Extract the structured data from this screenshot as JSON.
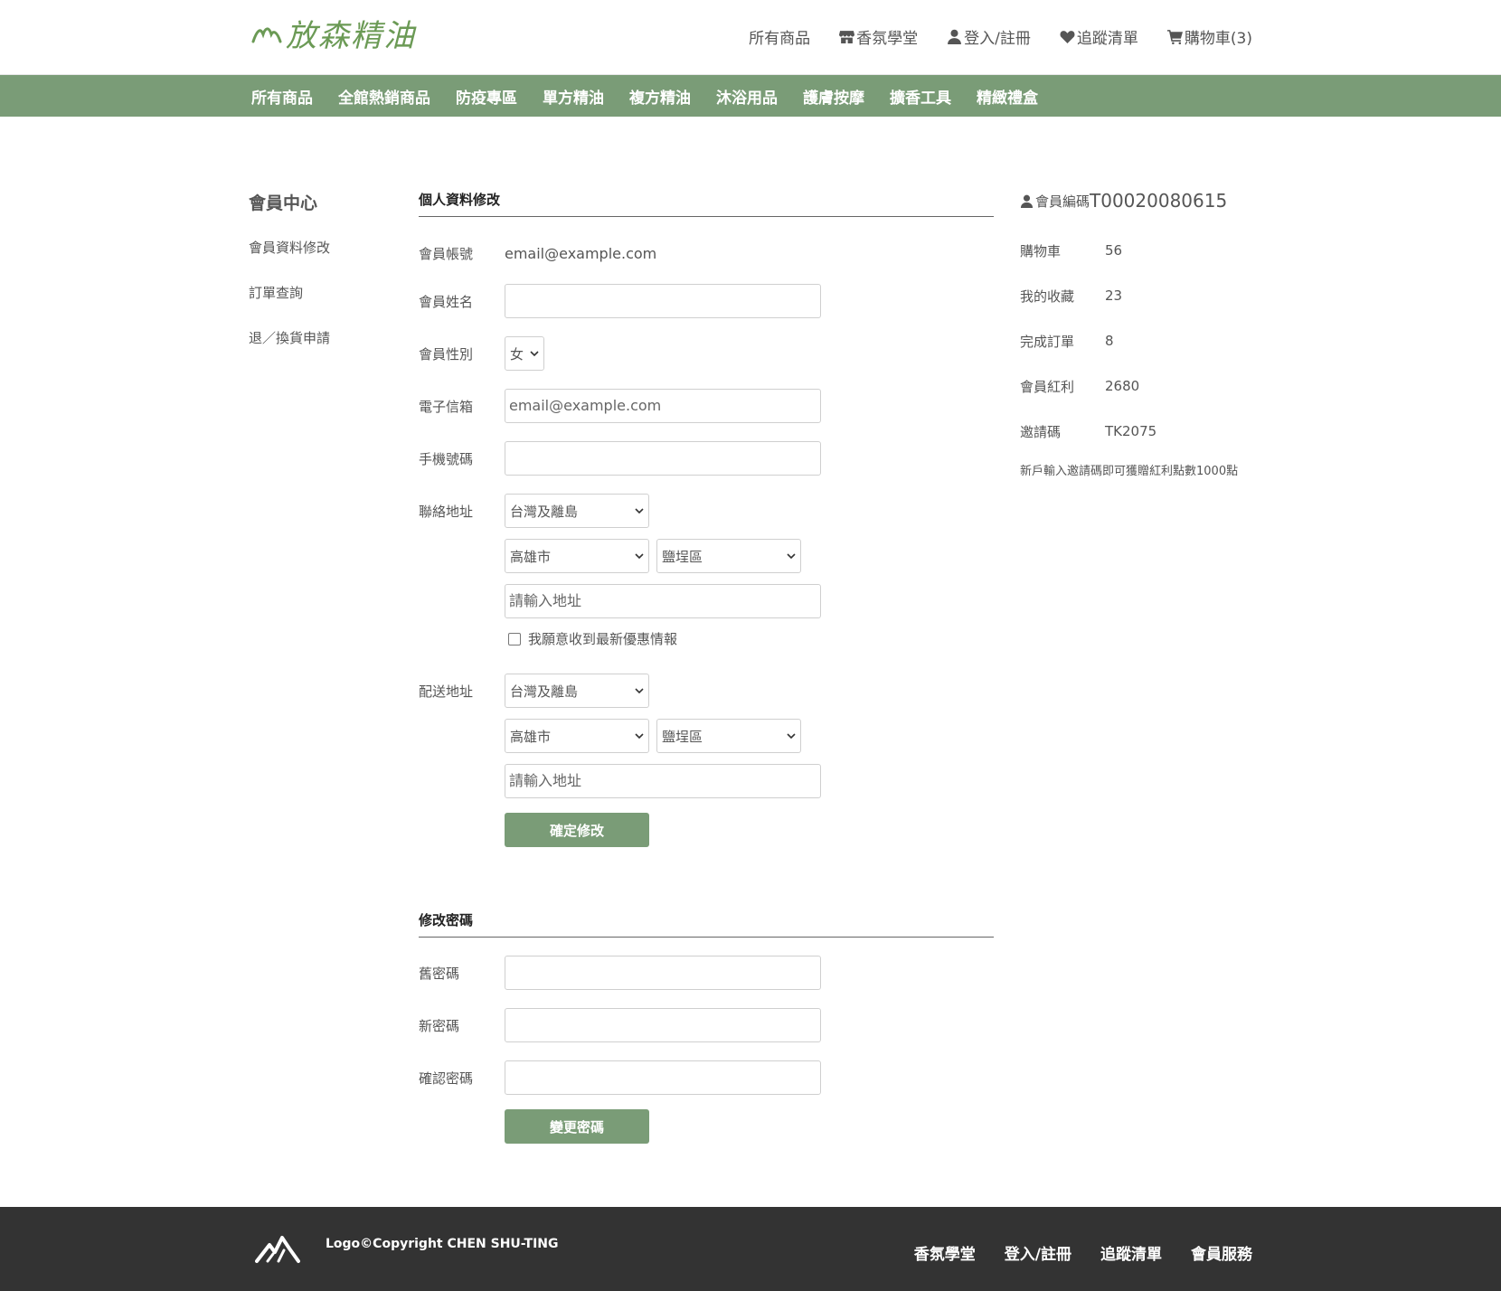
{
  "brand": {
    "logo_text": "放森精油",
    "accent": "#7a9c77",
    "logo_color": "#6b9a55"
  },
  "topnav": [
    {
      "label": "所有商品",
      "icon": ""
    },
    {
      "label": "香氛學堂",
      "icon": "store-icon"
    },
    {
      "label": "登入/註冊",
      "icon": "user-icon"
    },
    {
      "label": "追蹤清單",
      "icon": "heart-icon"
    },
    {
      "label": "購物車(3)",
      "icon": "cart-icon"
    }
  ],
  "categories": [
    "所有商品",
    "全館熱銷商品",
    "防疫專區",
    "單方精油",
    "複方精油",
    "沐浴用品",
    "護膚按摩",
    "擴香工具",
    "精緻禮盒"
  ],
  "sidebar": {
    "title": "會員中心",
    "items": [
      "會員資料修改",
      "訂單查詢",
      "退／換貨申請"
    ]
  },
  "profile": {
    "section_title": "個人資料修改",
    "account_label": "會員帳號",
    "account_value": "email@example.com",
    "name_label": "會員姓名",
    "name_value": "",
    "gender_label": "會員性別",
    "gender_value": "女",
    "email_label": "電子信箱",
    "email_placeholder": "email@example.com",
    "phone_label": "手機號碼",
    "phone_value": "",
    "contact_label": "聯絡地址",
    "contact_region": "台灣及離島",
    "contact_city": "高雄市",
    "contact_district": "鹽埕區",
    "contact_address_placeholder": "請輸入地址",
    "newsletter_label": "我願意收到最新優惠情報",
    "shipping_label": "配送地址",
    "shipping_region": "台灣及離島",
    "shipping_city": "高雄市",
    "shipping_district": "鹽埕區",
    "shipping_address_placeholder": "請輸入地址",
    "submit_label": "確定修改"
  },
  "password": {
    "section_title": "修改密碼",
    "old_label": "舊密碼",
    "new_label": "新密碼",
    "confirm_label": "確認密碼",
    "submit_label": "變更密碼"
  },
  "member": {
    "title_label": "會員編碼",
    "id": "T00020080615",
    "stats": [
      {
        "label": "購物車",
        "value": "56"
      },
      {
        "label": "我的收藏",
        "value": "23"
      },
      {
        "label": "完成訂單",
        "value": "8"
      },
      {
        "label": "會員紅利",
        "value": "2680"
      },
      {
        "label": "邀請碼",
        "value": "TK2075"
      }
    ],
    "note": "新戶輸入邀請碼即可獲贈紅利點數1000點"
  },
  "footer": {
    "copyright": "Logo©Copyright CHEN SHU-TING",
    "links": [
      "香氛學堂",
      "登入/註冊",
      "追蹤清單",
      "會員服務"
    ]
  }
}
